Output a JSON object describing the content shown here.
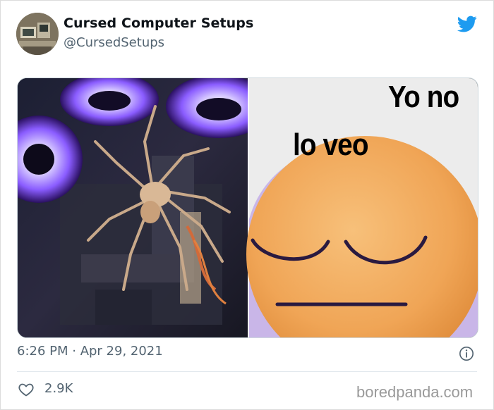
{
  "tweet": {
    "display_name": "Cursed Computer Setups",
    "handle": "@CursedSetups",
    "timestamp": "6:26 PM · Apr 29, 2021",
    "likes": "2.9K"
  },
  "media": {
    "meme_line1": "Yo no",
    "meme_line2": "lo veo"
  },
  "icons": {
    "bird": "twitter-bird-icon",
    "info": "info-icon",
    "like": "heart-icon"
  },
  "colors": {
    "brand": "#1d9bf0",
    "secondary_text": "#536471",
    "primary_text": "#0f1419"
  },
  "watermark": "boredpanda.com"
}
